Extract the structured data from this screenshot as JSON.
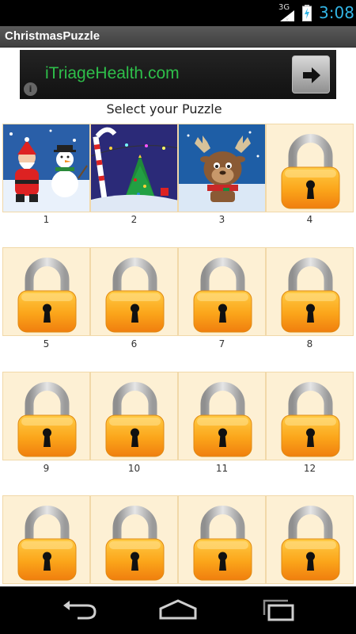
{
  "status_bar": {
    "network": "3G",
    "time": "3:08"
  },
  "title_bar": {
    "title": "ChristmasPuzzle"
  },
  "ad": {
    "text": "iTriageHealth.com",
    "info_glyph": "i",
    "accent": "#2ebf4a"
  },
  "main": {
    "heading": "Select your Puzzle"
  },
  "puzzles": [
    {
      "number": "1",
      "state": "unlocked",
      "art": "santa-snowman"
    },
    {
      "number": "2",
      "state": "unlocked",
      "art": "christmas-tree-night"
    },
    {
      "number": "3",
      "state": "unlocked",
      "art": "reindeer"
    },
    {
      "number": "4",
      "state": "locked"
    },
    {
      "number": "5",
      "state": "locked"
    },
    {
      "number": "6",
      "state": "locked"
    },
    {
      "number": "7",
      "state": "locked"
    },
    {
      "number": "8",
      "state": "locked"
    },
    {
      "number": "9",
      "state": "locked"
    },
    {
      "number": "10",
      "state": "locked"
    },
    {
      "number": "11",
      "state": "locked"
    },
    {
      "number": "12",
      "state": "locked"
    },
    {
      "number": "",
      "state": "locked"
    },
    {
      "number": "",
      "state": "locked"
    },
    {
      "number": "",
      "state": "locked"
    },
    {
      "number": "",
      "state": "locked"
    }
  ],
  "nav_bar": {
    "back": "back-icon",
    "home": "home-icon",
    "recents": "recent-apps-icon"
  }
}
